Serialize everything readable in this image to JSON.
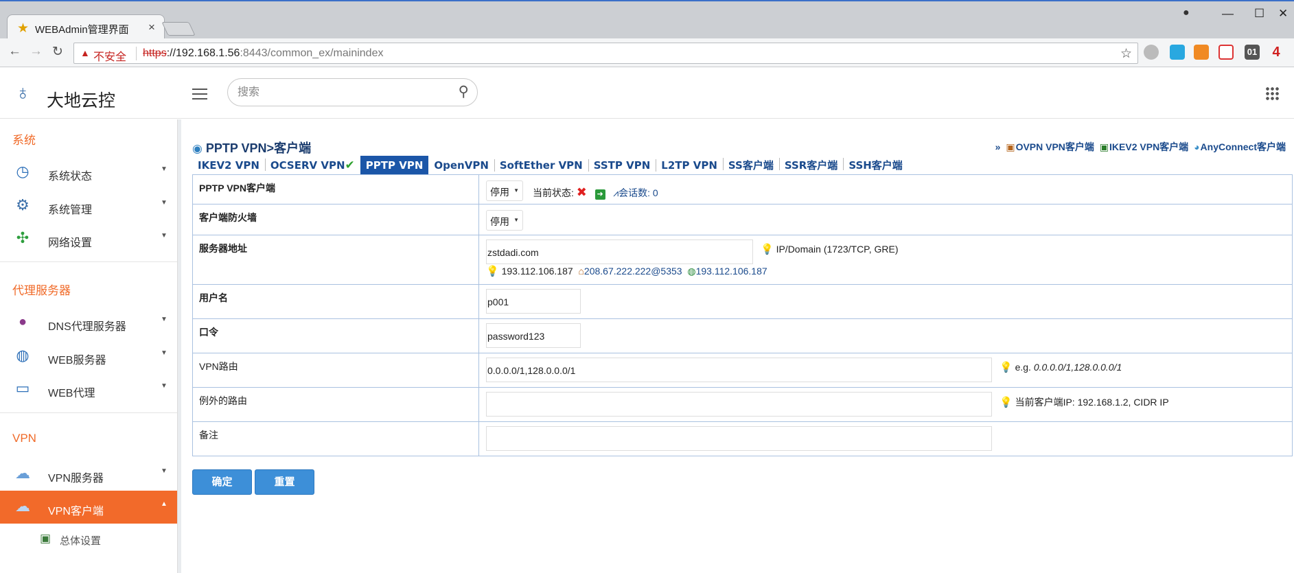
{
  "browser": {
    "tab_title": "WEBAdmin管理界面",
    "tab_close": "×",
    "insecure_label": "不安全",
    "url_scheme": "https",
    "url_host": "://192.168.1.56",
    "url_port": ":8443",
    "url_path": "/common_ex/mainindex",
    "ext_badge_4": "01",
    "ext_badge_5": "4"
  },
  "header": {
    "brand": "大地云控",
    "search_placeholder": "搜索"
  },
  "sidebar": {
    "sections": [
      {
        "title": "系统",
        "items": [
          "系统状态",
          "系统管理",
          "网络设置"
        ]
      },
      {
        "title": "代理服务器",
        "items": [
          "DNS代理服务器",
          "WEB服务器",
          "WEB代理"
        ]
      },
      {
        "title": "VPN",
        "items": [
          "VPN服务器",
          "VPN客户端"
        ]
      }
    ],
    "active_item": "VPN客户端",
    "sub_item": "总体设置"
  },
  "content": {
    "page_title": "PPTP VPN>客户端",
    "quick_links_prefix": "»",
    "quick_links": [
      "OVPN VPN客户端",
      "IKEV2 VPN客户端",
      "AnyConnect客户端"
    ],
    "tabs": [
      "IKEV2 VPN",
      "OCSERV VPN",
      "PPTP VPN",
      "OpenVPN",
      "SoftEther VPN",
      "SSTP VPN",
      "L2TP VPN",
      "SS客户端",
      "SSR客户端",
      "SSH客户端"
    ],
    "active_tab": "PPTP VPN",
    "form": {
      "client_label": "PPTP VPN客户端",
      "client_value": "停用",
      "status_label": "当前状态:",
      "sessions_label": "会话数: 0",
      "firewall_label": "客户端防火墙",
      "firewall_value": "停用",
      "server_label": "服务器地址",
      "server_value": "zstdadi.com",
      "server_hint": "IP/Domain   (1723/TCP, GRE)",
      "server_ip1": "193.112.106.187",
      "server_dns": "208.67.222.222@5353",
      "server_ip2": "193.112.106.187",
      "user_label": "用户名",
      "user_value": "p001",
      "pass_label": "口令",
      "pass_value": "password123",
      "route_label": "VPN路由",
      "route_value": "0.0.0.0/1,128.0.0.0/1",
      "route_hint_prefix": "e.g. ",
      "route_hint_example": "0.0.0.0/1,128.0.0.0/1",
      "except_label": "例外的路由",
      "except_value": "",
      "except_hint": "当前客户端IP: 192.168.1.2, CIDR IP",
      "note_label": "备注",
      "note_value": ""
    },
    "buttons": {
      "ok": "确定",
      "reset": "重置"
    }
  }
}
